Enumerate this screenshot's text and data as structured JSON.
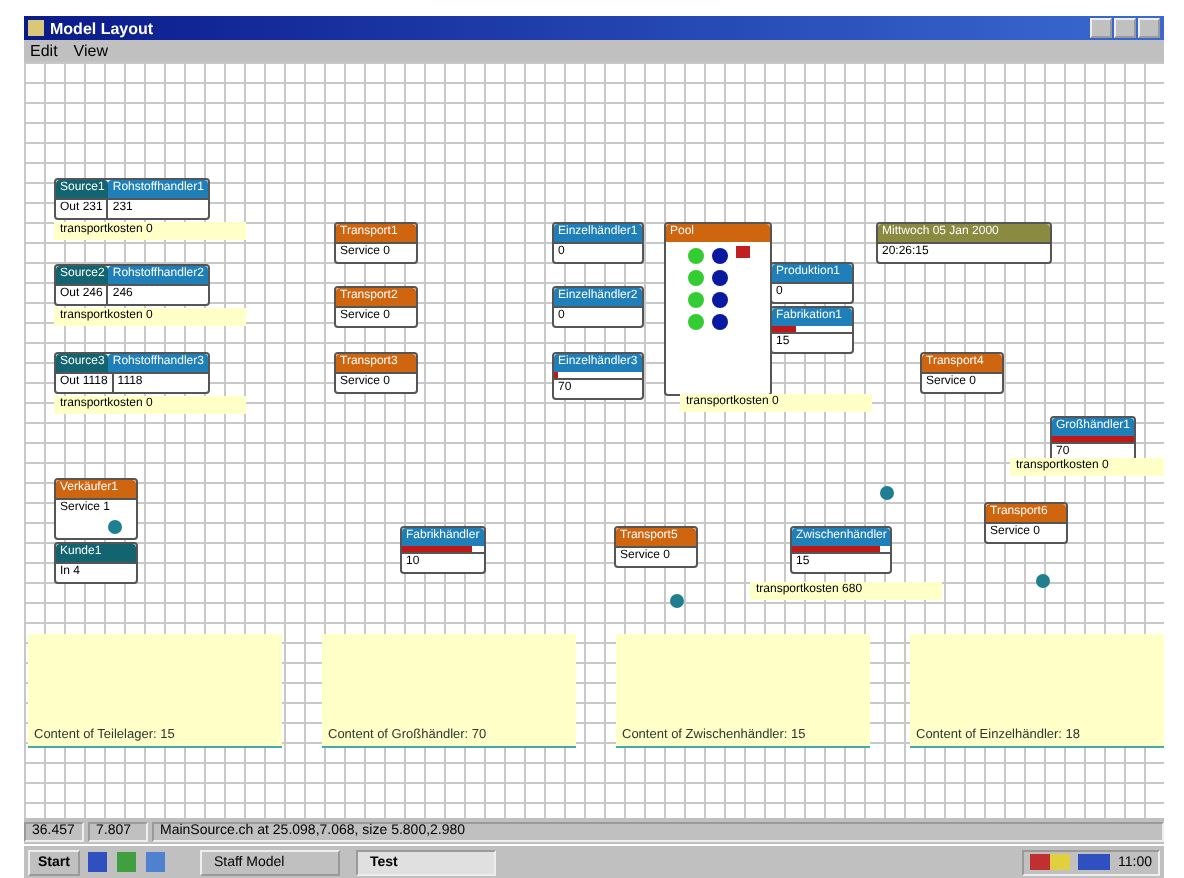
{
  "window": {
    "title": "Model Layout"
  },
  "menu": [
    {
      "label": "Edit"
    },
    {
      "label": "View"
    }
  ],
  "nodes": [
    {
      "kind": "source",
      "name": "Source1",
      "target": "Rohstoffhandler1",
      "out": "Out 231",
      "value": "231"
    },
    {
      "kind": "source",
      "name": "Source2",
      "target": "Rohstoffhandler2",
      "out": "Out 246",
      "value": "246"
    },
    {
      "kind": "source",
      "name": "Source3",
      "target": "Rohstoffhandler3",
      "out": "Out 1118",
      "value": "1118"
    },
    {
      "kind": "transport",
      "name": "Transport1",
      "value": "Service 0"
    },
    {
      "kind": "transport",
      "name": "Transport2",
      "value": "Service 0"
    },
    {
      "kind": "transport",
      "name": "Transport3",
      "value": "Service 0"
    },
    {
      "kind": "meter",
      "name": "Einzelhändler1",
      "value": "0"
    },
    {
      "kind": "meter",
      "name": "Einzelhändler2",
      "value": "0"
    },
    {
      "kind": "meter",
      "name": "Einzelhändler3",
      "value": "70",
      "level": 0.05
    },
    {
      "kind": "pool",
      "name": "Pool"
    },
    {
      "kind": "meter",
      "name": "Produktion1",
      "value": "0"
    },
    {
      "kind": "meter",
      "name": "Fabrikation1",
      "value": "15",
      "level": 0.3
    },
    {
      "kind": "clock",
      "name": "Mittwoch 05 Jan 2000",
      "value": "20:26:15"
    },
    {
      "kind": "transport",
      "name": "Transport4",
      "value": "Service 0"
    },
    {
      "kind": "meter",
      "name": "Großhändler1",
      "value": "70",
      "level": 1
    },
    {
      "kind": "transport",
      "name": "Verkäufer1",
      "value": "Service 1"
    },
    {
      "kind": "sink",
      "name": "Kunde1",
      "value": "In 4"
    },
    {
      "kind": "meter",
      "name": "Fabrikhändler",
      "value": "10",
      "level": 0.85
    },
    {
      "kind": "transport",
      "name": "Transport5",
      "value": "Service 0"
    },
    {
      "kind": "meter",
      "name": "Zwischenhändler",
      "value": "15",
      "level": 0.9
    },
    {
      "kind": "transport",
      "name": "Transport6",
      "value": "Service 0"
    }
  ],
  "notes": [
    {
      "text": "transportkosten 0"
    },
    {
      "text": "transportkosten 0"
    },
    {
      "text": "transportkosten 0"
    },
    {
      "text": "transportkosten 0"
    },
    {
      "text": "transportkosten 0"
    },
    {
      "text": "transportkosten 680"
    }
  ],
  "panels": [
    {
      "label": "Content of Teilelager: 15"
    },
    {
      "label": "Content of Großhändler: 70"
    },
    {
      "label": "Content of Zwischenhändler: 15"
    },
    {
      "label": "Content of Einzelhändler: 18"
    }
  ],
  "status_bar": [
    "36.457",
    "7.807",
    "MainSource.ch at 25.098,7.068, size 5.800,2.980"
  ],
  "taskbar": {
    "start": "Start",
    "tasks": [
      {
        "label": "Staff Model",
        "selected": false
      },
      {
        "label": "Test",
        "selected": true
      }
    ],
    "clock": "11:00"
  }
}
